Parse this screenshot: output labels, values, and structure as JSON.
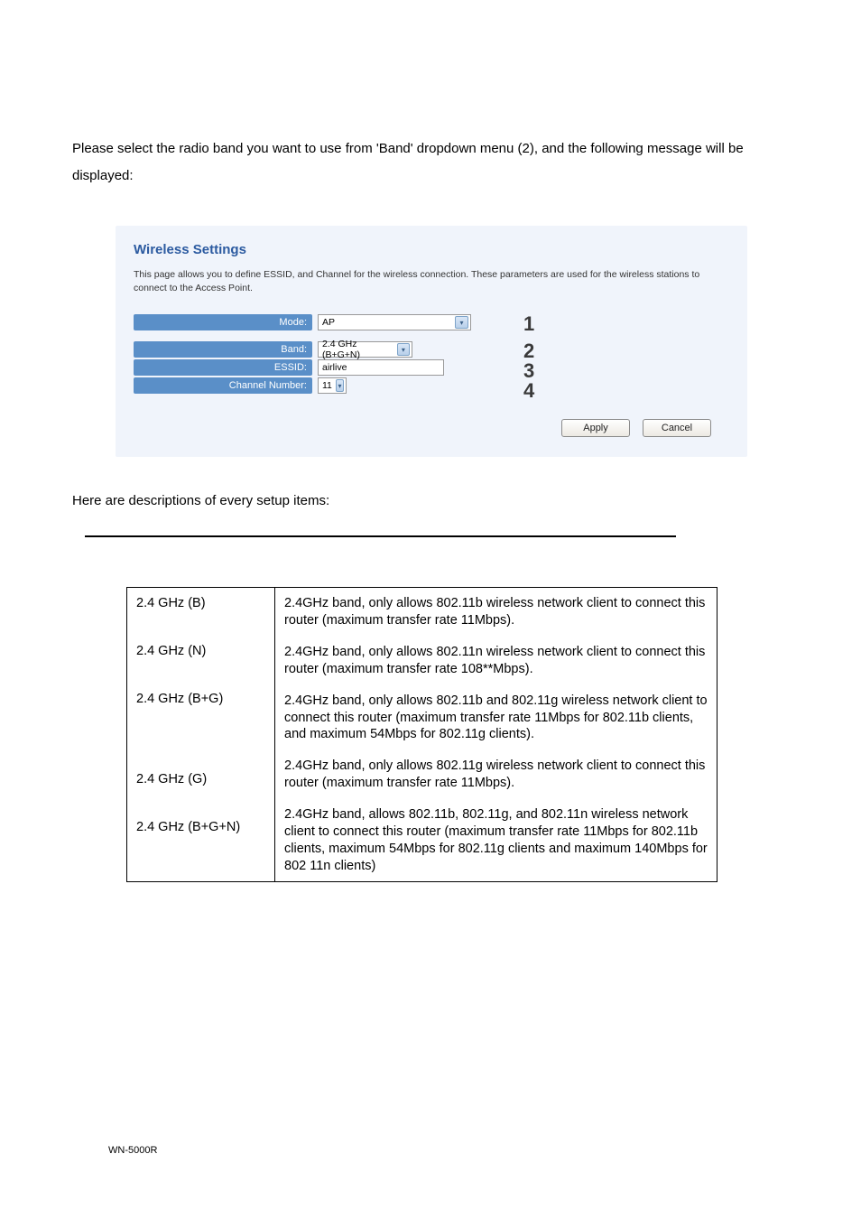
{
  "intro": "Please select the radio band you want to use from 'Band' dropdown menu (2), and the following message will be displayed:",
  "panel": {
    "title": "Wireless Settings",
    "desc": "This page allows you to define ESSID, and Channel for the wireless connection. These parameters are used for the wireless stations to connect to the Access Point.",
    "fields": {
      "mode": {
        "label": "Mode:",
        "value": "AP"
      },
      "band": {
        "label": "Band:",
        "value": "2.4 GHz (B+G+N)"
      },
      "essid": {
        "label": "ESSID:",
        "value": "airlive"
      },
      "channel": {
        "label": "Channel Number:",
        "value": "11"
      }
    },
    "markers": {
      "m1": "1",
      "m2": "2",
      "m3": "3",
      "m4": "4"
    },
    "buttons": {
      "apply": "Apply",
      "cancel": "Cancel"
    }
  },
  "desc_line": "Here are descriptions of every setup items:",
  "table": [
    {
      "a": "2.4 GHz (B)",
      "b": "2.4GHz band, only allows 802.11b wireless network client to connect this router (maximum transfer rate 11Mbps)."
    },
    {
      "a": "2.4 GHz (N)",
      "b": "2.4GHz band, only allows 802.11n wireless network client to connect this router (maximum transfer rate 108**Mbps)."
    },
    {
      "a": "2.4 GHz (B+G)",
      "b": "2.4GHz band, only allows 802.11b and 802.11g wireless network client to connect this router (maximum transfer rate 11Mbps for 802.11b clients, and maximum 54Mbps for 802.11g clients)."
    },
    {
      "a": "2.4 GHz (G)",
      "b": "2.4GHz band, only allows 802.11g wireless network client to connect this router (maximum transfer rate 11Mbps)."
    },
    {
      "a": "2.4 GHz (B+G+N)",
      "b": "2.4GHz band, allows 802.11b, 802.11g, and 802.11n wireless network client to connect this router (maximum transfer rate 11Mbps for 802.11b clients, maximum 54Mbps for 802.11g clients  and maximum 140Mbps for 802 11n clients)"
    }
  ],
  "footer": "WN-5000R"
}
